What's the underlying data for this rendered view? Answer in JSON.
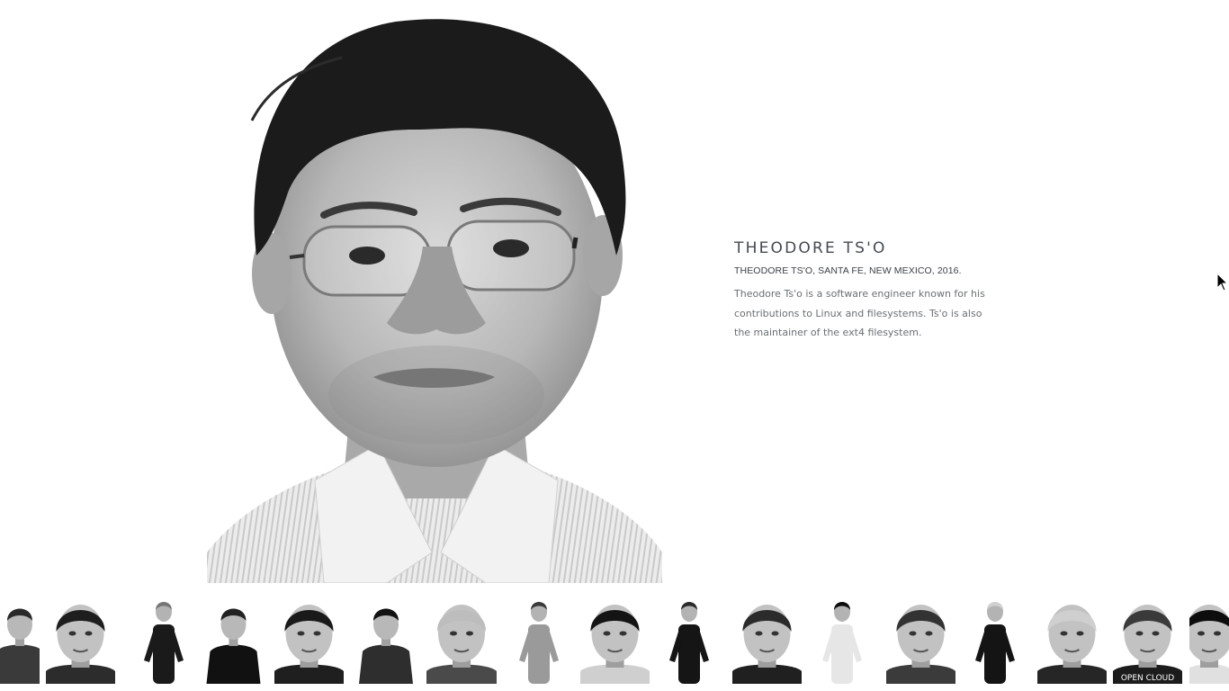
{
  "profile": {
    "name": "THEODORE TS'O",
    "caption": "THEODORE TS'O, SANTA FE, NEW MEXICO, 2016.",
    "bio": "Theodore Ts'o is a software engineer known for his contributions to Linux and filesystems. Ts'o is also the maintainer of the ext4 filesystem."
  },
  "colors": {
    "name_text": "#444a52",
    "caption_text": "#3c4048",
    "bio_text": "#6b6f74",
    "background": "#ffffff"
  },
  "thumbnails": [
    {
      "kind": "half-body",
      "shirt": "#3a3a3a",
      "hair": "#2a2a2a"
    },
    {
      "kind": "bust",
      "shirt": "#2c2c2c",
      "hair": "#1e1e1e"
    },
    {
      "kind": "full",
      "shirt": "#1a1a1a",
      "hair": "#777777"
    },
    {
      "kind": "half-body",
      "shirt": "#111111",
      "hair": "#222222"
    },
    {
      "kind": "bust",
      "shirt": "#1f1f1f",
      "hair": "#1a1a1a"
    },
    {
      "kind": "half-body",
      "shirt": "#2e2e2e",
      "hair": "#111111"
    },
    {
      "kind": "bust",
      "shirt": "#4a4a4a",
      "hair": "#bdbdbd"
    },
    {
      "kind": "full",
      "shirt": "#9a9a9a",
      "hair": "#3a3a3a"
    },
    {
      "kind": "bust",
      "shirt": "#cfcfcf",
      "hair": "#141414"
    },
    {
      "kind": "full",
      "shirt": "#151515",
      "hair": "#2a2a2a"
    },
    {
      "kind": "bust",
      "shirt": "#202020",
      "hair": "#2b2b2b"
    },
    {
      "kind": "full",
      "shirt": "#e6e6e6",
      "hair": "#0c0c0c"
    },
    {
      "kind": "bust",
      "shirt": "#3b3b3b",
      "hair": "#333333"
    },
    {
      "kind": "full",
      "shirt": "#141414",
      "hair": "#d0d0d0"
    },
    {
      "kind": "bust",
      "shirt": "#262626",
      "hair": "#cfcfcf"
    },
    {
      "kind": "bust-print",
      "shirt": "#1c1c1c",
      "hair": "#3a3a3a",
      "print": "OPEN CLOUD"
    },
    {
      "kind": "bust",
      "shirt": "#e0e0e0",
      "hair": "#0d0d0d"
    }
  ]
}
